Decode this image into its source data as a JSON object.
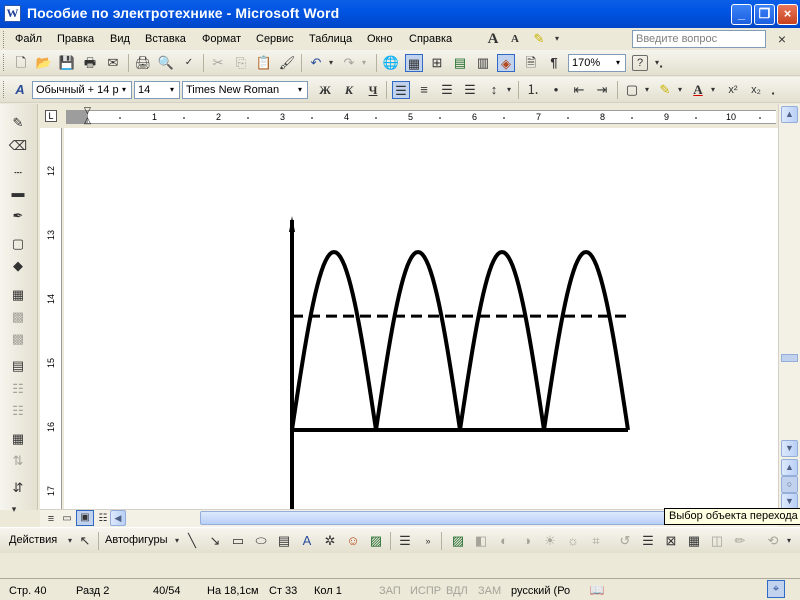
{
  "window": {
    "title": "Пособие по электротехнике - Microsoft Word",
    "app_icon_letter": "W"
  },
  "menu": {
    "items": [
      "Файл",
      "Правка",
      "Вид",
      "Вставка",
      "Формат",
      "Сервис",
      "Таблица",
      "Окно",
      "Справка"
    ],
    "help_placeholder": "Введите вопрос",
    "close_doc": "×"
  },
  "standard_toolbar": {
    "zoom": "170%",
    "help_icon": "?"
  },
  "format_toolbar": {
    "style": "Обычный + 14 р",
    "size": "14",
    "font": "Times New Roman",
    "bold": "Ж",
    "italic": "К",
    "underline": "Ч"
  },
  "rulers": {
    "horizontal": [
      "1",
      "2",
      "3",
      "4",
      "5",
      "6",
      "7",
      "8",
      "9",
      "10"
    ],
    "vertical": [
      "12",
      "13",
      "14",
      "15",
      "16",
      "17"
    ]
  },
  "figure": {
    "description_marks": {
      "arches": 4,
      "dashed_level_fraction": 0.64
    }
  },
  "tooltip": "Выбор объекта перехода",
  "drawing_toolbar": {
    "actions": "Действия",
    "autoshapes": "Автофигуры"
  },
  "status": {
    "page": "Стр. 40",
    "section": "Разд 2",
    "pages": "40/54",
    "at": "На 18,1см",
    "line": "Ст 33",
    "col": "Кол 1",
    "rec": "ЗАП",
    "trk": "ИСПР",
    "ext": "ВДЛ",
    "ovr": "ЗАМ",
    "language": "русский (Ро"
  }
}
